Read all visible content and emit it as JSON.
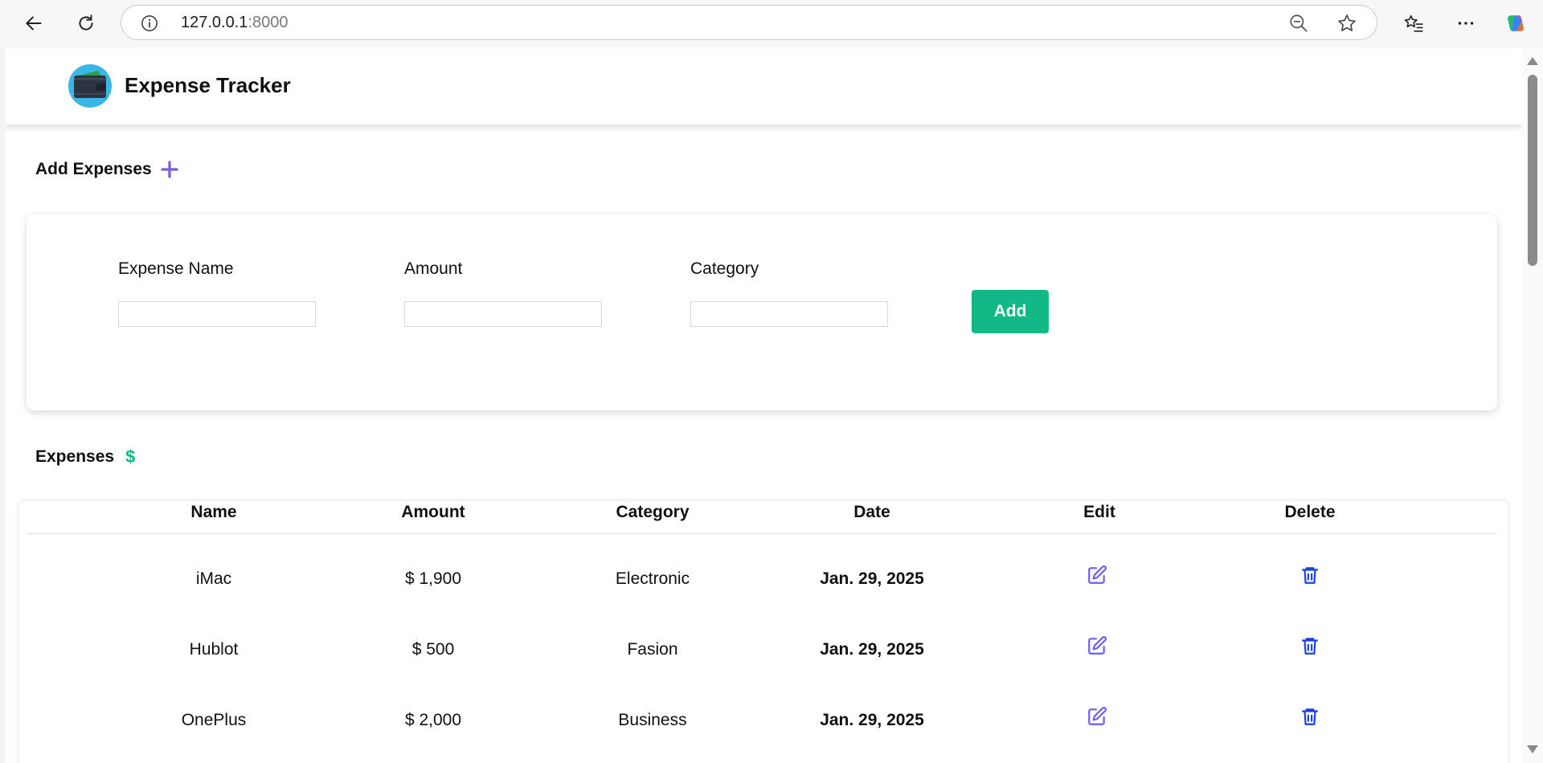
{
  "browser": {
    "url_host": "127.0.0.1",
    "url_port": ":8000"
  },
  "app": {
    "title": "Expense Tracker"
  },
  "add_section": {
    "title": "Add Expenses",
    "labels": {
      "name": "Expense Name",
      "amount": "Amount",
      "category": "Category"
    },
    "values": {
      "name": "",
      "amount": "",
      "category": ""
    },
    "add_label": "Add"
  },
  "expenses_section": {
    "title": "Expenses",
    "icon": "$",
    "columns": [
      "Name",
      "Amount",
      "Category",
      "Date",
      "Edit",
      "Delete"
    ],
    "rows": [
      {
        "name": "iMac",
        "amount": "$ 1,900",
        "category": "Electronic",
        "date": "Jan. 29, 2025"
      },
      {
        "name": "Hublot",
        "amount": "$ 500",
        "category": "Fasion",
        "date": "Jan. 29, 2025"
      },
      {
        "name": "OnePlus",
        "amount": "$ 2,000",
        "category": "Business",
        "date": "Jan. 29, 2025"
      }
    ]
  },
  "colors": {
    "accent_green": "#12b886",
    "accent_purple": "#7b5cd6",
    "icon_blue": "#1c3fe0"
  }
}
